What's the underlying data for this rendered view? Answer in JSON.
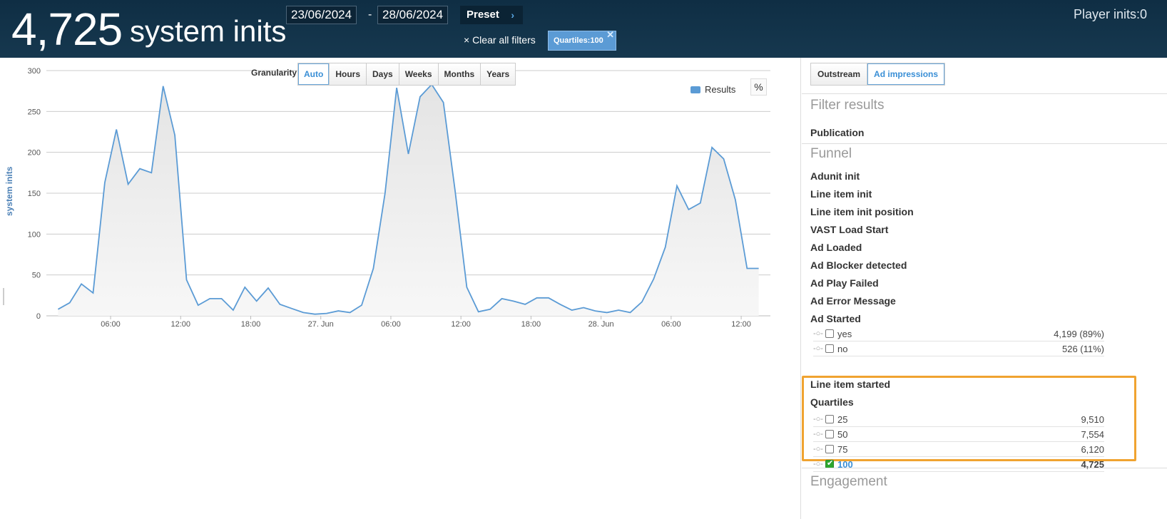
{
  "header": {
    "count": "4,725",
    "count_label": "system inits",
    "date_from": "23/06/2024",
    "date_sep": "-",
    "date_to": "28/06/2024",
    "preset_label": "Preset",
    "preset_chev": "›",
    "clear_filters": "× Clear all filters",
    "filter_chip": "Quartiles:100",
    "filter_chip_close": "✕",
    "player_inits": "Player inits:0"
  },
  "granularity": {
    "label": "Granularity",
    "options": [
      "Auto",
      "Hours",
      "Days",
      "Weeks",
      "Months",
      "Years"
    ],
    "active": "Auto"
  },
  "legend": {
    "label": "Results",
    "pct": "%"
  },
  "colors": {
    "line": "#5b9bd5",
    "fill": "#e8e8e8",
    "highlight": "#f0a330",
    "header_bg": "#0f2e44"
  },
  "chart_data": {
    "type": "area",
    "ylabel": "system inits",
    "ylim": [
      0,
      300
    ],
    "yticks": [
      0,
      50,
      100,
      150,
      200,
      250,
      300
    ],
    "x_tick_labels": [
      "06:00",
      "12:00",
      "18:00",
      "27. Jun",
      "06:00",
      "12:00",
      "18:00",
      "28. Jun",
      "06:00",
      "12:00"
    ],
    "x_tick_hours": [
      6,
      12,
      18,
      24,
      30,
      36,
      42,
      48,
      54,
      60
    ],
    "x_range_hours": [
      0.5,
      62.5
    ],
    "series": [
      {
        "values_x_hours": [
          1.5,
          2.5,
          3.5,
          4.5,
          5.5,
          6.5,
          7.5,
          8.5,
          9.5,
          10.5,
          11.5,
          12.5,
          13.5,
          14.5,
          15.5,
          16.5,
          17.5,
          18.5,
          19.5,
          20.5,
          21.5,
          22.5,
          23.5,
          24.5,
          25.5,
          26.5,
          27.5,
          28.5,
          29.5,
          30.5,
          31.5,
          32.5,
          33.5,
          34.5,
          35.5,
          36.5,
          37.5,
          38.5,
          39.5,
          40.5,
          41.5,
          42.5,
          43.5,
          44.5,
          45.5,
          46.5,
          47.5,
          48.5,
          49.5,
          50.5,
          51.5,
          52.5,
          53.5,
          54.5,
          55.5,
          56.5,
          57.5,
          58.5,
          59.5,
          60.5,
          61.5
        ],
        "values": [
          8,
          16,
          39,
          28,
          163,
          228,
          161,
          180,
          175,
          281,
          221,
          44,
          13,
          21,
          21,
          7,
          35,
          18,
          34,
          14,
          9,
          4,
          2,
          3,
          6,
          4,
          13,
          58,
          150,
          279,
          198,
          268,
          283,
          261,
          153,
          35,
          5,
          8,
          21,
          18,
          14,
          22,
          22,
          14,
          7,
          10,
          6,
          4,
          7,
          4,
          17,
          45,
          84,
          159,
          130,
          138,
          206,
          192,
          142,
          58,
          58
        ]
      }
    ]
  },
  "right_panel": {
    "tabs": [
      "Outstream",
      "Ad impressions"
    ],
    "active_tab": "Ad impressions",
    "filter_results": "Filter results",
    "publication": "Publication",
    "funnel_title": "Funnel",
    "funnel_items": [
      "Adunit init",
      "Line item init",
      "Line item init position",
      "VAST Load Start",
      "Ad Loaded",
      "Ad Blocker detected",
      "Ad Play Failed",
      "Ad Error Message",
      "Ad Started"
    ],
    "ad_started_rows": [
      {
        "label": "yes",
        "value": "4,199 (89%)"
      },
      {
        "label": "no",
        "value": "526 (11%)"
      }
    ],
    "line_item_started": "Line item started",
    "quartiles_title": "Quartiles",
    "quartile_rows": [
      {
        "label": "25",
        "value": "9,510",
        "checked": false
      },
      {
        "label": "50",
        "value": "7,554",
        "checked": false
      },
      {
        "label": "75",
        "value": "6,120",
        "checked": false
      },
      {
        "label": "100",
        "value": "4,725",
        "checked": true
      }
    ],
    "toggle_glyph": "-○-",
    "engagement_title": "Engagement"
  }
}
